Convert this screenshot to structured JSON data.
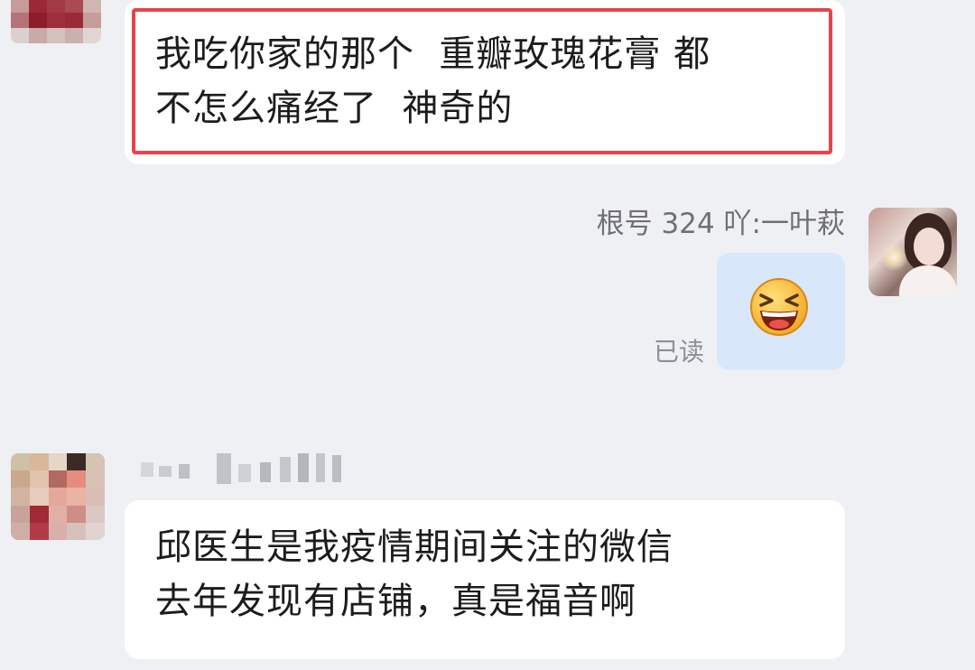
{
  "messages": [
    {
      "side": "left",
      "highlighted": true,
      "lines": [
        "我吃你家的那个  重瓣玫瑰花膏 都",
        "不怎么痛经了  神奇的"
      ]
    },
    {
      "side": "right",
      "sender": "根号 324 吖:一叶萩",
      "content_icon": "laughing-emoji-icon",
      "status": "已读"
    },
    {
      "side": "left",
      "lines": [
        "邱医生是我疫情期间关注的微信",
        "去年发现有店铺，真是福音啊"
      ]
    }
  ],
  "colors": {
    "background": "#eff0f4",
    "bubble_incoming": "#ffffff",
    "bubble_outgoing": "#d9e7fb",
    "highlight_border": "#e8434a",
    "text_primary": "#1c1c1c",
    "text_secondary": "#6f6f75",
    "read_status": "#8e8f96"
  }
}
